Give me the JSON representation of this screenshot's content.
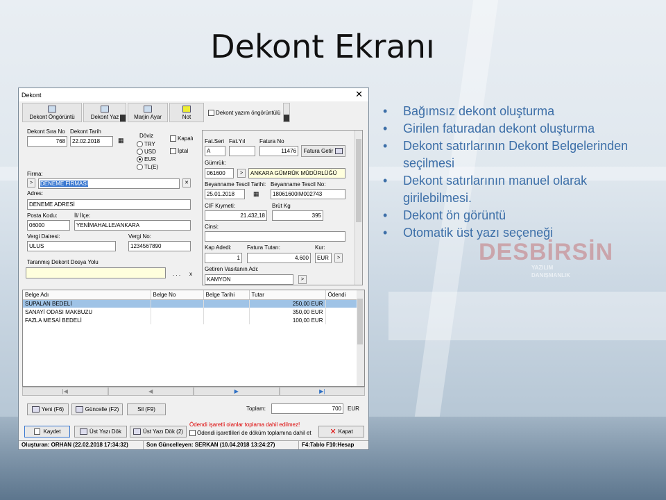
{
  "slide": {
    "title": "Dekont Ekranı",
    "bullets": [
      "Bağımsız dekont oluşturma",
      "Girilen faturadan dekont oluşturma",
      "Dekont satırlarının Dekont Belgelerinden seçilmesi",
      "Dekont satırlarının manuel olarak girilebilmesi.",
      "Dekont ön görüntü",
      "Otomatik üst yazı seçeneği"
    ],
    "bg_mark": "DESBİRSİN",
    "bg_sub1": "YAZILIM",
    "bg_sub2": "DANIŞMANLIK"
  },
  "window": {
    "title": "Dekont",
    "close": "✕",
    "toolbar": {
      "preview": "Dekont Öngörüntü",
      "print": "Dekont Yaz",
      "margin": "Marjin Ayar",
      "note": "Not",
      "print_preview_check": "Dekont yazım öngörüntülü"
    },
    "left": {
      "sira_label": "Dekont Sıra No",
      "sira": "768",
      "tarih_label": "Dekont Tarih",
      "tarih": "22.02.2018",
      "doviz_label": "Döviz",
      "currencies": [
        "TRY",
        "USD",
        "EUR",
        "TL(E)"
      ],
      "selected_currency": "EUR",
      "kapali": "Kapalı",
      "iptal": "İptal",
      "firma_label": "Firma:",
      "firma": "DENEME FİRMASI",
      "adres_label": "Adres:",
      "adres": "DENEME ADRESİ",
      "posta_label": "Posta Kodu:",
      "posta": "06000",
      "ilce_label": "İl/ İlçe:",
      "ilce": "YENİMAHALLE/ANKARA",
      "vd_label": "Vergi Dairesi:",
      "vd": "ULUS",
      "vn_label": "Vergi No:",
      "vn": "1234567890",
      "taranmis_label": "Taranmış Dekont Dosya Yolu",
      "taranmis": "",
      "dots": ". . .",
      "x": "x"
    },
    "right": {
      "fatseri_label": "Fat.Seri",
      "fatseri": "A",
      "fatyil_label": "Fat.Yıl",
      "fatyil": "",
      "fatno_label": "Fatura No",
      "fatno": "11476",
      "fatura_getir": "Fatura Getir",
      "gumruk_label": "Gümrük:",
      "gumruk_kod": "061600",
      "gumruk_ad": "ANKARA GÜMRÜK MÜDÜRLÜĞÜ",
      "bey_tarih_label": "Beyanname Tescil Tarihi:",
      "bey_tarih": "25.01.2018",
      "bey_no_label": "Beyanname Tescil No:",
      "bey_no": "18061600IM002743",
      "cif_label": "CIF Kıymeti:",
      "cif": "21.432,18",
      "brut_label": "Brüt Kg",
      "brut": "395",
      "cinsi_label": "Cinsi:",
      "cinsi": "",
      "kap_label": "Kap Adedi:",
      "kap": "1",
      "fat_tutar_label": "Fatura Tutarı:",
      "fat_tutar": "4.600",
      "kur_label": "Kur:",
      "kur": "EUR",
      "getiren_label": "Getiren Vasıtanın Adı:",
      "getiren": "KAMYON"
    },
    "grid": {
      "headers": [
        "Belge Adı",
        "Belge No",
        "Belge Tarihi",
        "Tutar",
        "Ödendi"
      ],
      "rows": [
        {
          "ad": "SUPALAN BEDELİ",
          "no": "",
          "tarih": "",
          "tutar": "250,00 EUR",
          "odendi": ""
        },
        {
          "ad": "SANAYİ ODASI MAKBUZU",
          "no": "",
          "tarih": "",
          "tutar": "350,00 EUR",
          "odendi": ""
        },
        {
          "ad": "FAZLA MESAİ BEDELİ",
          "no": "",
          "tarih": "",
          "tutar": "100,00 EUR",
          "odendi": ""
        }
      ]
    },
    "nav": [
      "|◀",
      "◀",
      "▶",
      "▶|"
    ],
    "actions": {
      "yeni": "Yeni (F6)",
      "guncelle": "Güncelle (F2)",
      "sil": "Sil (F9)",
      "toplam_label": "Toplam:",
      "toplam": "700",
      "toplam_cur": "EUR"
    },
    "bottom": {
      "kaydet": "Kaydet",
      "ust_yazi": "Üst Yazı Dök",
      "ust_yazi2": "Üst Yazı Dök (2)",
      "warn": "Ödendi işaretli olanlar toplama dahil edilmez!",
      "warn2": "Ödendi işaretlileri de döküm toplamına dahil et",
      "kapat": "Kapat"
    },
    "status": {
      "olusturan": "Oluşturan: ORHAN (22.02.2018 17:34:32)",
      "guncelleyen": "Son Güncelleyen: SERKAN (10.04.2018 13:24:27)",
      "keys": "F4:Tablo F10:Hesap"
    }
  }
}
